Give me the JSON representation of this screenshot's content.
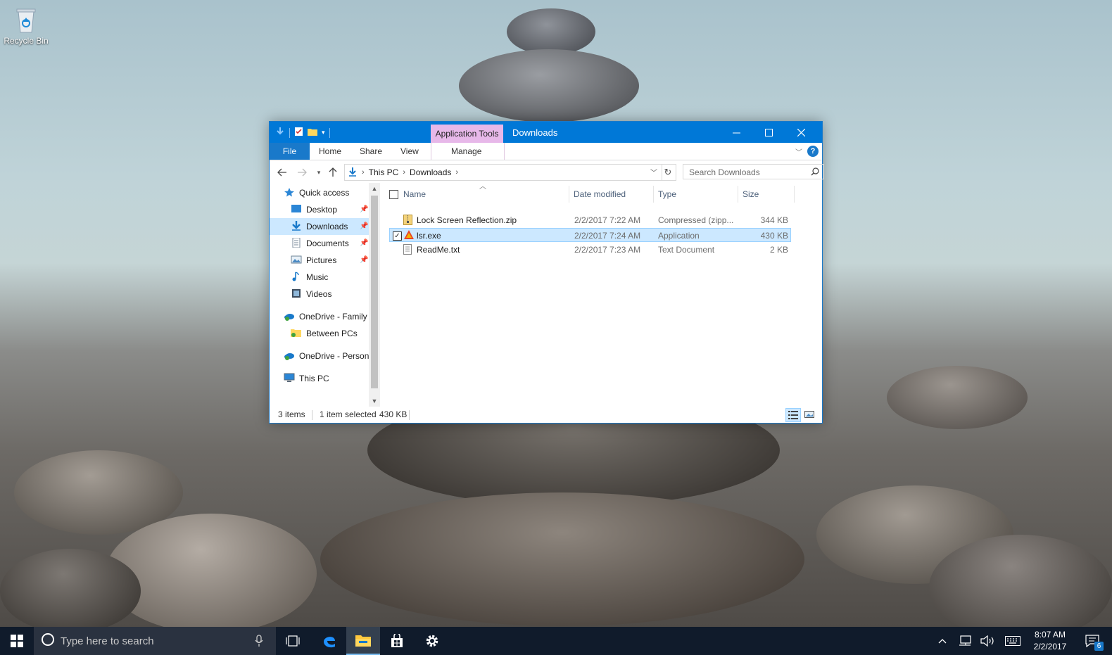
{
  "desktop": {
    "recycle_bin_label": "Recycle Bin"
  },
  "window": {
    "context_tab": "Application Tools",
    "title": "Downloads",
    "ribbon_tabs": [
      "File",
      "Home",
      "Share",
      "View"
    ],
    "manage_tab": "Manage",
    "address": {
      "crumbs": [
        "This PC",
        "Downloads"
      ]
    },
    "search_placeholder": "Search Downloads",
    "nav_pane": {
      "quick_access": "Quick access",
      "items": [
        {
          "label": "Desktop",
          "icon": "desktop-icon",
          "pinned": true
        },
        {
          "label": "Downloads",
          "icon": "downloads-icon",
          "pinned": true,
          "selected": true
        },
        {
          "label": "Documents",
          "icon": "documents-icon",
          "pinned": true
        },
        {
          "label": "Pictures",
          "icon": "pictures-icon",
          "pinned": true
        },
        {
          "label": "Music",
          "icon": "music-icon",
          "pinned": false
        },
        {
          "label": "Videos",
          "icon": "videos-icon",
          "pinned": false
        }
      ],
      "onedrive_family": "OneDrive - Family",
      "between_pcs": "Between PCs",
      "onedrive_personal": "OneDrive - Personal",
      "this_pc": "This PC"
    },
    "columns": [
      "Name",
      "Date modified",
      "Type",
      "Size"
    ],
    "files": [
      {
        "name": "Lock Screen Reflection.zip",
        "date": "2/2/2017 7:22 AM",
        "type": "Compressed (zipp...",
        "size": "344 KB",
        "icon": "zip-folder-icon",
        "selected": false
      },
      {
        "name": "lsr.exe",
        "date": "2/2/2017 7:24 AM",
        "type": "Application",
        "size": "430 KB",
        "icon": "app-warning-icon",
        "selected": true
      },
      {
        "name": "ReadMe.txt",
        "date": "2/2/2017 7:23 AM",
        "type": "Text Document",
        "size": "2 KB",
        "icon": "text-file-icon",
        "selected": false
      }
    ],
    "status": {
      "items": "3 items",
      "selected": "1 item selected",
      "size": "430 KB"
    }
  },
  "taskbar": {
    "search_placeholder": "Type here to search",
    "clock_time": "8:07 AM",
    "clock_date": "2/2/2017",
    "notification_count": "6"
  },
  "colors": {
    "title_blue": "#0078d7",
    "context_tab_pink": "#e7b8e9",
    "selection": "#cce8ff",
    "taskbar": "#101b2b"
  }
}
